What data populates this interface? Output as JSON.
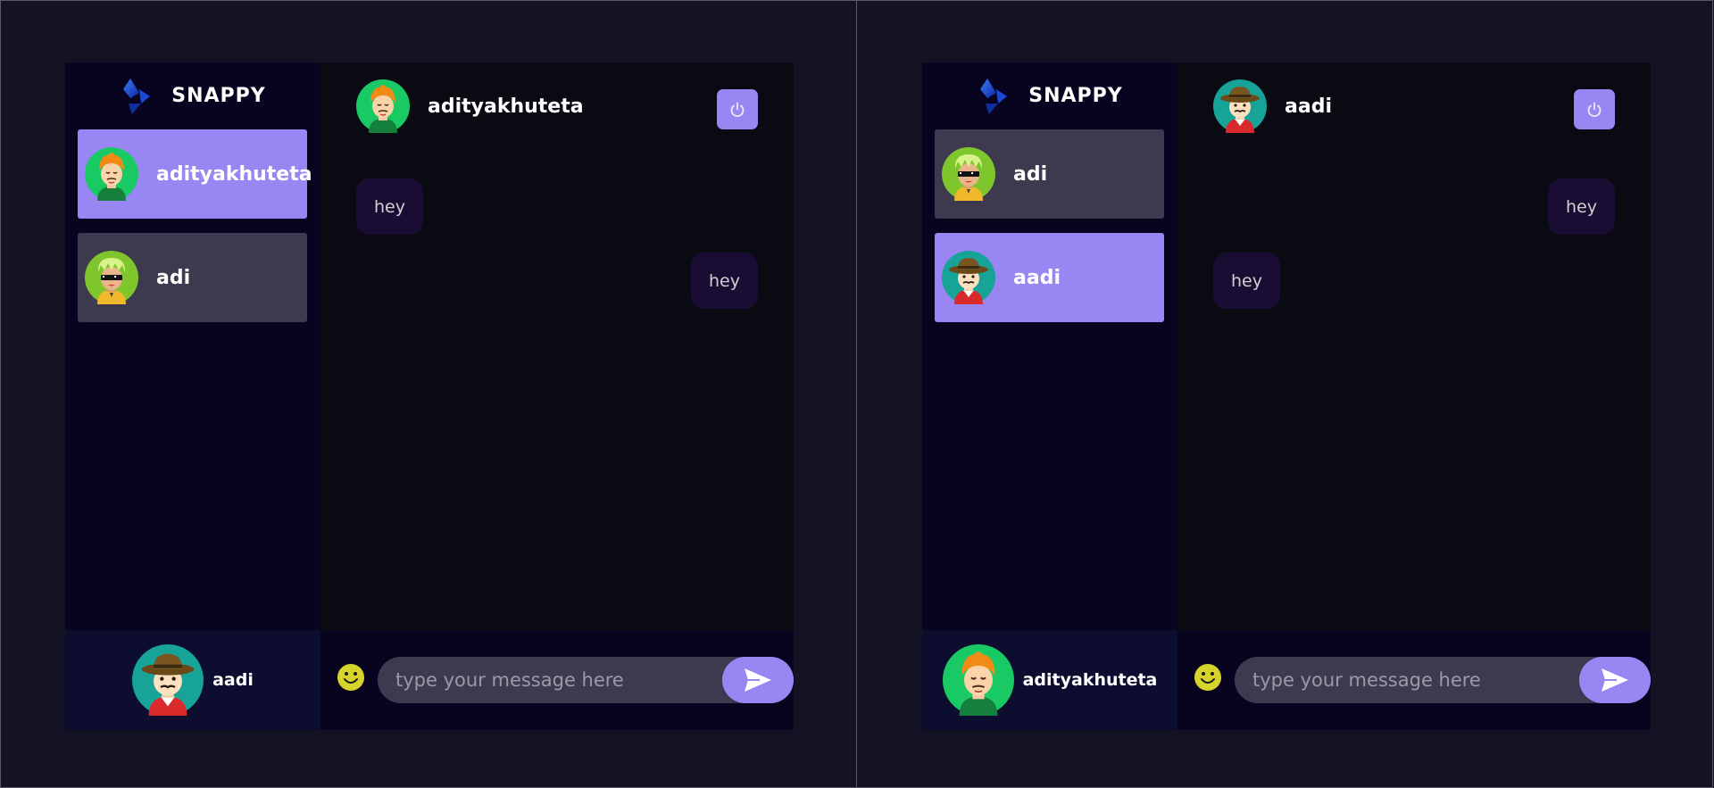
{
  "app": {
    "brand": "SNAPPY"
  },
  "colors": {
    "accent": "#9a86f3",
    "background": "#131324",
    "sidebar": "#080420",
    "contact": "#3d3a50",
    "bubble": "#1a0d33"
  },
  "windows": [
    {
      "contacts": [
        {
          "name": "adityakhuteta",
          "avatar": "orange-turban-avatar",
          "selected": true
        },
        {
          "name": "adi",
          "avatar": "sunglasses-avatar",
          "selected": false
        }
      ],
      "current_user": {
        "name": "aadi",
        "avatar": "hat-mustache-avatar"
      },
      "chat": {
        "header_name": "adityakhuteta",
        "header_avatar": "orange-turban-avatar",
        "logout_icon": "power-icon",
        "messages": [
          {
            "text": "hey",
            "direction": "received"
          },
          {
            "text": "hey",
            "direction": "sent"
          }
        ],
        "input_placeholder": "type your message here"
      }
    },
    {
      "contacts": [
        {
          "name": "adi",
          "avatar": "sunglasses-avatar",
          "selected": false
        },
        {
          "name": "aadi",
          "avatar": "hat-mustache-avatar",
          "selected": true
        }
      ],
      "current_user": {
        "name": "adityakhuteta",
        "avatar": "orange-turban-avatar"
      },
      "chat": {
        "header_name": "aadi",
        "header_avatar": "hat-mustache-avatar",
        "logout_icon": "power-icon",
        "messages": [
          {
            "text": "hey",
            "direction": "sent"
          },
          {
            "text": "hey",
            "direction": "received"
          }
        ],
        "input_placeholder": "type your message here"
      }
    }
  ]
}
